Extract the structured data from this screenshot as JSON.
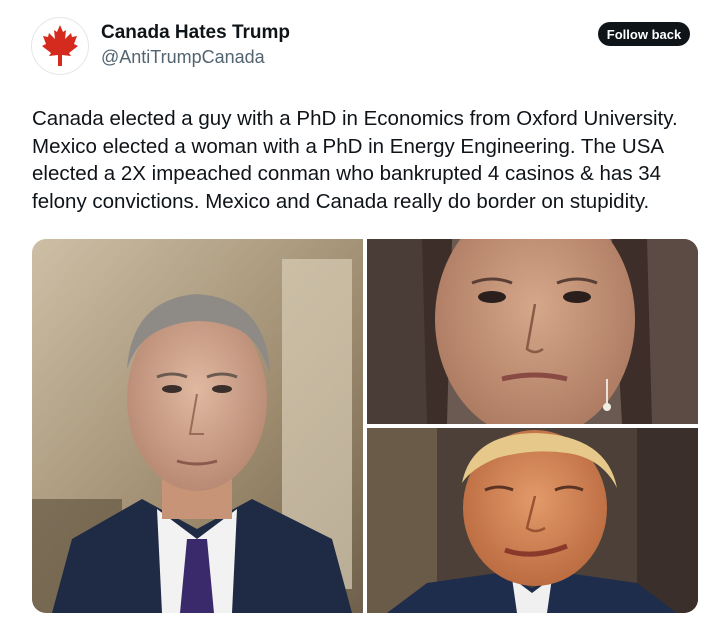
{
  "tweet": {
    "author_name": "Canada Hates Trump",
    "author_handle": "@AntiTrumpCanada",
    "follow_button_label": "Follow back",
    "text": "Canada elected a guy with a PhD in Economics from Oxford University.\nMexico elected a woman with a PhD in Energy Engineering. The USA\nelected a 2X impeached conman who bankrupted 4 casinos & has 34\nfelony convictions. Mexico and Canada really do border on stupidity.",
    "avatar_icon": "maple-leaf-icon",
    "accent_color": "#d52b1e"
  },
  "media": {
    "photo_count": 3,
    "photos": [
      {
        "subject": "man-in-suit-portrait"
      },
      {
        "subject": "woman-face-closeup"
      },
      {
        "subject": "man-smirking-closeup"
      }
    ]
  }
}
